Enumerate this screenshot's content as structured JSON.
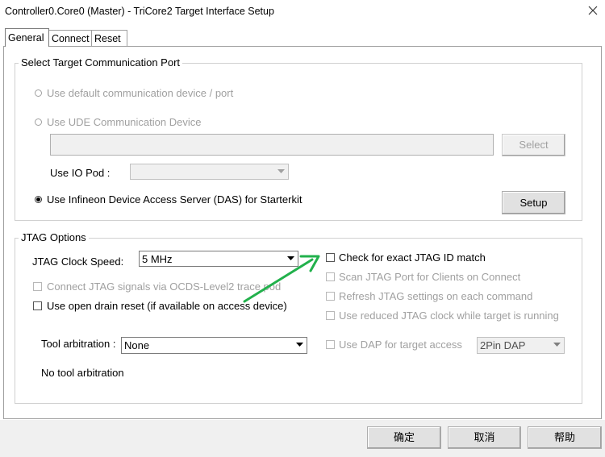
{
  "window": {
    "title": "Controller0.Core0 (Master) - TriCore2 Target Interface Setup",
    "close_icon": "close-icon"
  },
  "tabs": [
    {
      "label": "General"
    },
    {
      "label": "Connect"
    },
    {
      "label": "Reset"
    }
  ],
  "port_group": {
    "title": "Select Target Communication Port",
    "opt_default": "Use default communication device / port",
    "opt_ude": "Use UDE Communication Device",
    "ude_device_value": "",
    "select_label": "Select",
    "io_pod_label": "Use IO Pod :",
    "io_pod_value": "",
    "opt_das": "Use Infineon Device Access Server (DAS) for Starterkit",
    "setup_label": "Setup",
    "selected": "das"
  },
  "jtag_group": {
    "title": "JTAG Options",
    "clock_label": "JTAG Clock Speed:",
    "clock_value": "5 MHz",
    "connect_ocds": "Connect JTAG signals via OCDS-Level2 trace pod",
    "open_drain": "Use open drain reset (if available on access device)",
    "tool_arb_label": "Tool arbitration :",
    "tool_arb_value": "None",
    "tool_arb_status": "No tool arbitration",
    "check_id": "Check for exact JTAG ID match",
    "scan_port": "Scan JTAG Port for Clients on Connect",
    "refresh": "Refresh JTAG settings on each command",
    "reduced_clock": "Use reduced JTAG clock while target is running",
    "use_dap": "Use DAP for target access",
    "dap_value": "2Pin DAP"
  },
  "annotation": {
    "arrow_color": "#22b14c"
  },
  "footer": {
    "ok": "确定",
    "cancel": "取消",
    "help": "帮助"
  }
}
